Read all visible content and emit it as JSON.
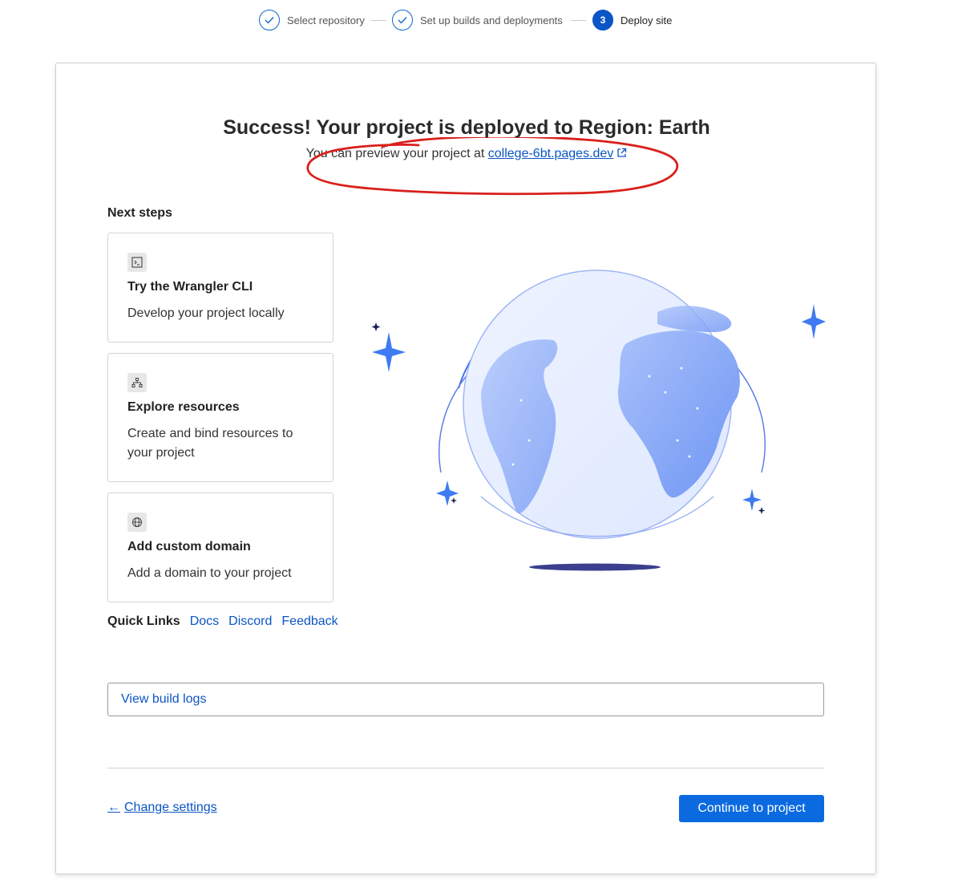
{
  "stepper": {
    "steps": [
      {
        "label": "Select repository",
        "state": "done"
      },
      {
        "label": "Set up builds and deployments",
        "state": "done"
      },
      {
        "label": "Deploy site",
        "number": "3",
        "state": "active"
      }
    ]
  },
  "header": {
    "title": "Success! Your project is deployed to Region: Earth",
    "subtitle_prefix": "You can preview your project at",
    "preview_link": "college-6bt.pages.dev"
  },
  "next_steps": {
    "title": "Next steps",
    "cards": [
      {
        "icon": "terminal-icon",
        "title": "Try the Wrangler CLI",
        "description": "Develop your project locally"
      },
      {
        "icon": "sitemap-icon",
        "title": "Explore resources",
        "description": "Create and bind resources to your project"
      },
      {
        "icon": "globe-icon",
        "title": "Add custom domain",
        "description": "Add a domain to your project"
      }
    ]
  },
  "quick_links": {
    "label": "Quick Links",
    "links": [
      "Docs",
      "Discord",
      "Feedback"
    ]
  },
  "build_logs_label": "View build logs",
  "footer": {
    "change_settings": "Change settings",
    "continue": "Continue to project"
  },
  "colors": {
    "accent": "#0b55c6",
    "primary_button": "#0b6ae0",
    "annotation": "#d9201c",
    "globe_fill": "#7fa3f5"
  }
}
